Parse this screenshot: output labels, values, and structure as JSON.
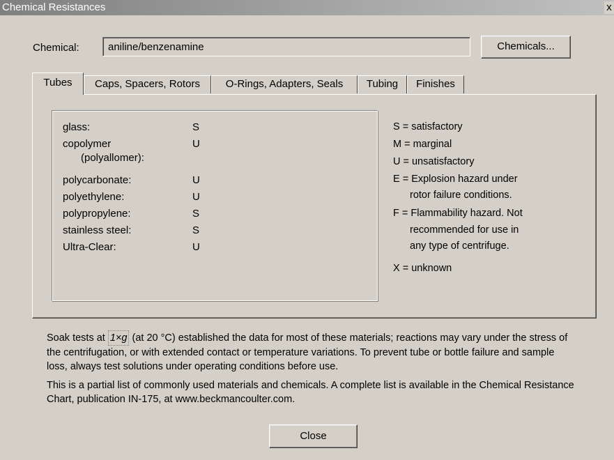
{
  "window": {
    "title": "Chemical Resistances",
    "close_glyph": "x"
  },
  "chemical": {
    "label": "Chemical:",
    "value": "aniline/benzenamine",
    "button": "Chemicals..."
  },
  "tabs": [
    {
      "label": "Tubes",
      "active": true
    },
    {
      "label": "Caps, Spacers, Rotors",
      "active": false
    },
    {
      "label": "O-Rings, Adapters, Seals",
      "active": false
    },
    {
      "label": "Tubing",
      "active": false
    },
    {
      "label": "Finishes",
      "active": false
    }
  ],
  "materials": [
    {
      "name": "glass:",
      "rating": "S"
    },
    {
      "name": "copolymer",
      "name2": "(polyallomer):",
      "rating": "U"
    },
    {
      "name": "polycarbonate:",
      "rating": "U"
    },
    {
      "name": "polyethylene:",
      "rating": "U"
    },
    {
      "name": "polypropylene:",
      "rating": "S"
    },
    {
      "name": "stainless steel:",
      "rating": "S"
    },
    {
      "name": "Ultra-Clear:",
      "rating": "U"
    }
  ],
  "legend": [
    "S = satisfactory",
    "M = marginal",
    "U = unsatisfactory",
    "E = Explosion hazard under",
    "rotor failure conditions.",
    "F = Flammability hazard.  Not",
    "recommended for use in",
    "any type of centrifuge.",
    "X = unknown"
  ],
  "notes": {
    "soak_pre": "Soak tests at ",
    "soak_g": "1×g",
    "soak_post": " (at 20 °C) established the data for most of these materials;  reactions may vary under the stress of the centrifugation, or with extended contact or temperature variations.  To prevent tube or bottle failure and sample loss, always test solutions under operating conditions before use.",
    "partial": "This is a partial list of commonly used materials and chemicals.  A complete list is available in the Chemical Resistance Chart, publication IN-175, at www.beckmancoulter.com."
  },
  "close_button": "Close"
}
